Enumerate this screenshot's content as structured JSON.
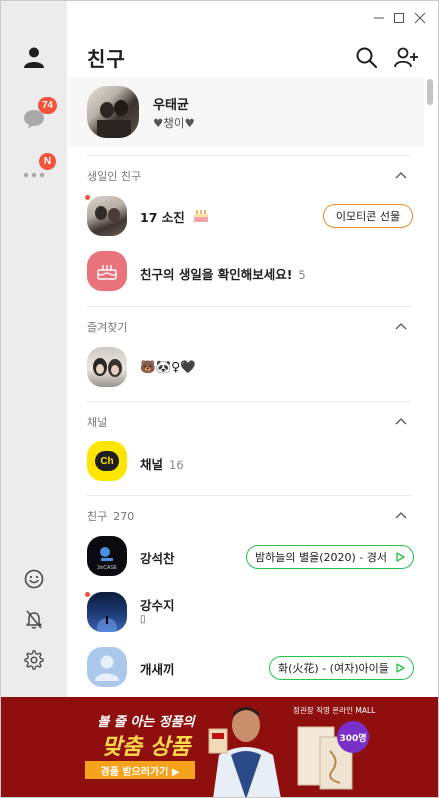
{
  "window": {
    "controls": [
      "minimize",
      "maximize",
      "close"
    ]
  },
  "rail": {
    "chats_badge": "74",
    "more_badge": "N"
  },
  "header": {
    "title": "친구"
  },
  "profile": {
    "name": "우태균",
    "status": "♥챙이♥"
  },
  "birthday": {
    "title": "생일인 친구",
    "friend_name": "17 소진",
    "friend_action": "이모티콘 선물",
    "check_label": "친구의 생일을 확인해보세요!",
    "check_count": "5"
  },
  "favorites": {
    "title": "즐겨찾기",
    "friend_name": "🐻🐼♀🖤"
  },
  "channel": {
    "title": "채널",
    "name": "채널",
    "count": "16",
    "logo_text": "Ch"
  },
  "friends": {
    "title": "친구",
    "count": "270",
    "items": [
      {
        "name": "강석찬",
        "music": "밤하늘의 별을(2020) - 경서",
        "status": ""
      },
      {
        "name": "강수지",
        "music": "",
        "status": "▯"
      },
      {
        "name": "개새끼",
        "music": "화(火花) - (여자)아이들",
        "status": ""
      }
    ]
  },
  "ad": {
    "line1": "볼 줄 아는 정품의",
    "line2": "맞춤 상품",
    "cta": "경품 받으러가기 ▶",
    "brand": "정관장 직영 온라인 MALL",
    "badge": "300명"
  },
  "colors": {
    "accent_badge": "#f2533a",
    "gift_outline": "#f08a24",
    "music_outline": "#27c24c",
    "channel_yellow": "#fee500",
    "birthday_tile": "#e8737a",
    "ad_background": "#8f0f0f"
  }
}
